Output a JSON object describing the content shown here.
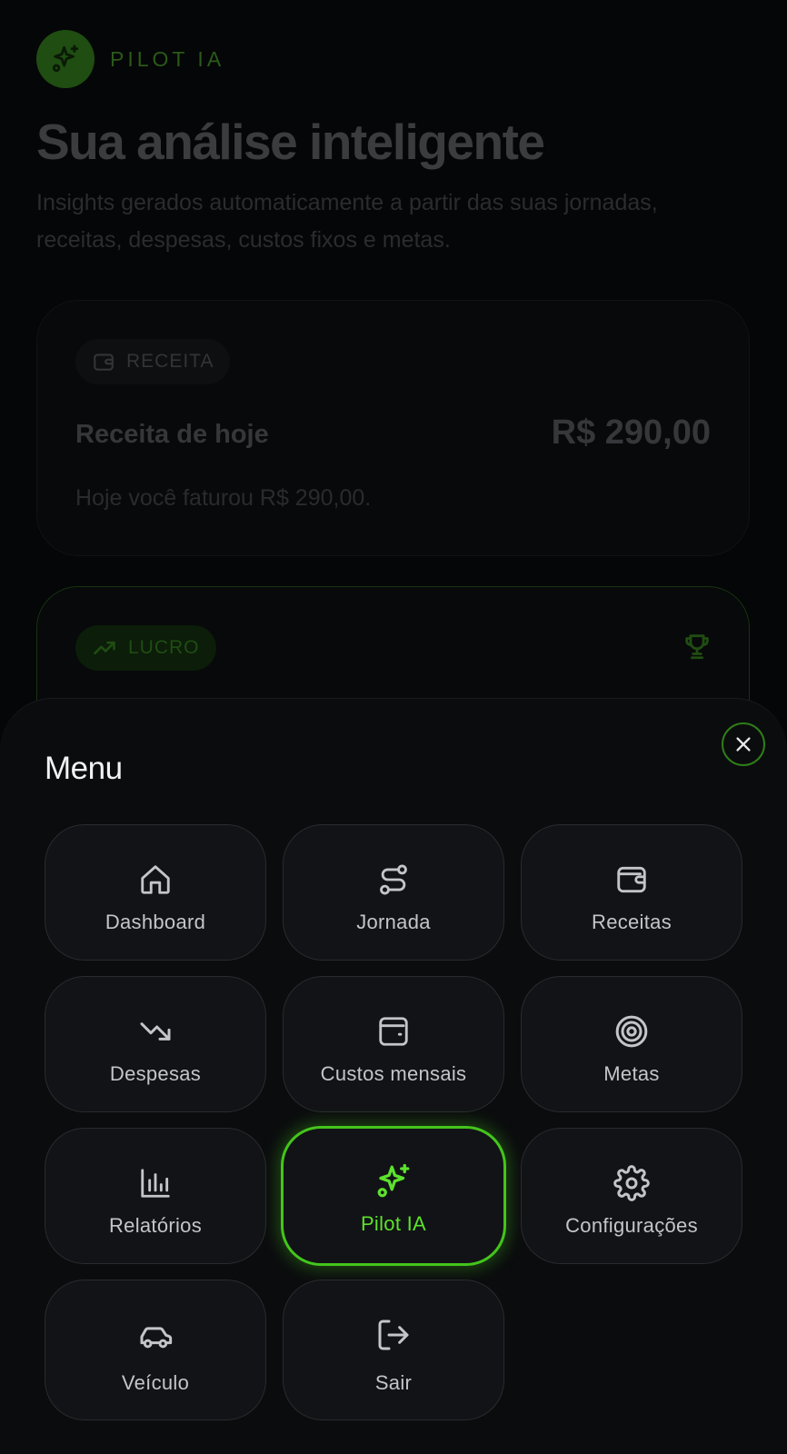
{
  "app": {
    "name": "PILOT IA",
    "logo_icon": "sparkles-icon",
    "accent": "#44c51c"
  },
  "hero": {
    "title": "Sua análise inteligente",
    "subtitle": "Insights gerados automaticamente a partir das suas jornadas, receitas, despesas, custos fixos e metas."
  },
  "cards": [
    {
      "chip_icon": "wallet-icon",
      "chip": "RECEITA",
      "label": "Receita de hoje",
      "value": "R$ 290,00",
      "description": "Hoje você faturou R$ 290,00."
    },
    {
      "chip_icon": "trending-up-icon",
      "chip": "LUCRO",
      "badge_icon": "trophy-icon"
    }
  ],
  "menu": {
    "title": "Menu",
    "close_icon": "close-icon",
    "items": [
      {
        "label": "Dashboard",
        "icon": "home-icon"
      },
      {
        "label": "Jornada",
        "icon": "route-icon"
      },
      {
        "label": "Receitas",
        "icon": "wallet-icon"
      },
      {
        "label": "Despesas",
        "icon": "trending-down-icon"
      },
      {
        "label": "Custos mensais",
        "icon": "wallet-card-icon"
      },
      {
        "label": "Metas",
        "icon": "target-icon"
      },
      {
        "label": "Relatórios",
        "icon": "bar-chart-icon"
      },
      {
        "label": "Pilot IA",
        "icon": "sparkles-icon",
        "active": true
      },
      {
        "label": "Configurações",
        "icon": "settings-icon"
      },
      {
        "label": "Veículo",
        "icon": "car-icon"
      },
      {
        "label": "Sair",
        "icon": "logout-icon"
      }
    ]
  }
}
